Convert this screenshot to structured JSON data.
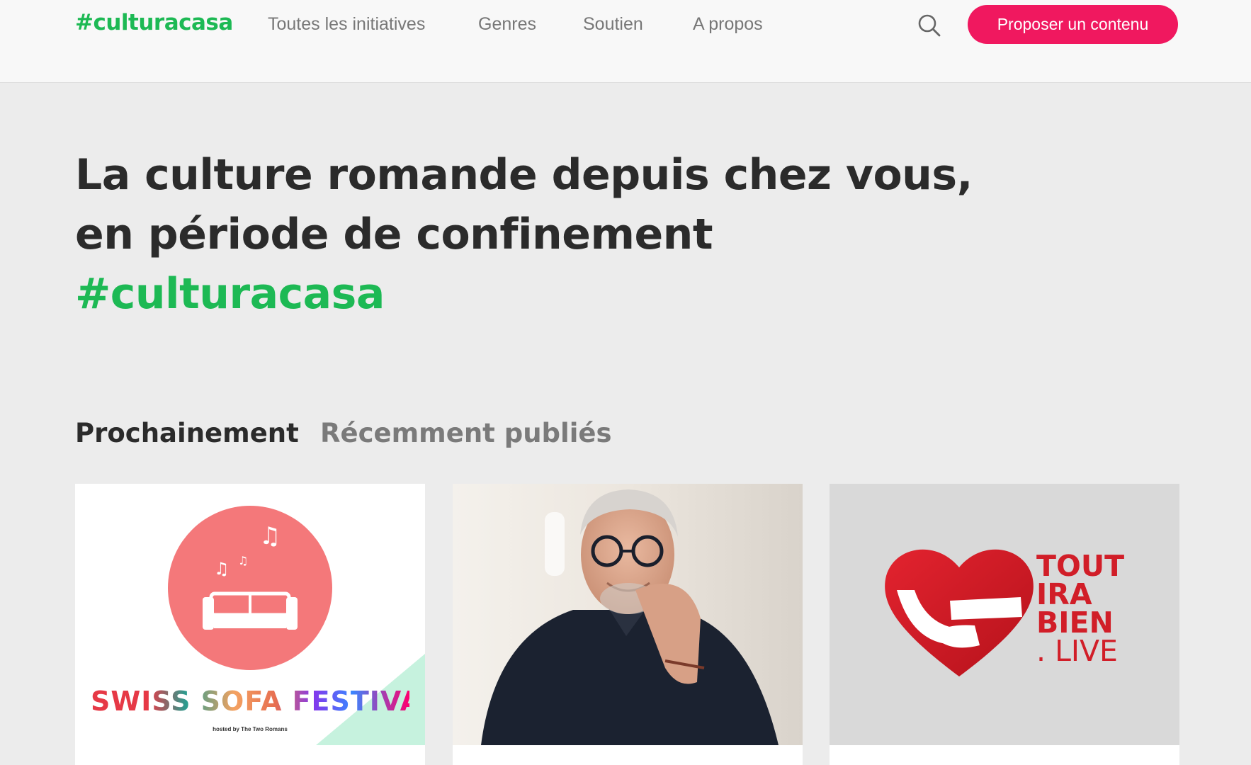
{
  "header": {
    "logo": "#culturacasa",
    "nav": [
      "Toutes les initiatives",
      "Genres",
      "Soutien",
      "A propos"
    ],
    "search_icon": "search-icon",
    "cta_label": "Proposer un contenu"
  },
  "hero": {
    "line1": "La culture romande depuis chez vous,",
    "line2": "en période de confinement",
    "hashtag": "#culturacasa"
  },
  "tabs": [
    "Prochainement",
    "Récemment publiés"
  ],
  "cards": [
    {
      "logo_text": "SWISS SOFA FESTIVAL",
      "hosted": "hosted by The Two Romans"
    },
    {
      "image": "portrait"
    },
    {
      "logo_lines": [
        "TOUT",
        "IRA",
        "BIEN",
        ". LIVE"
      ]
    }
  ],
  "colors": {
    "accent_green": "#1db954",
    "cta_pink": "#f0185f"
  }
}
